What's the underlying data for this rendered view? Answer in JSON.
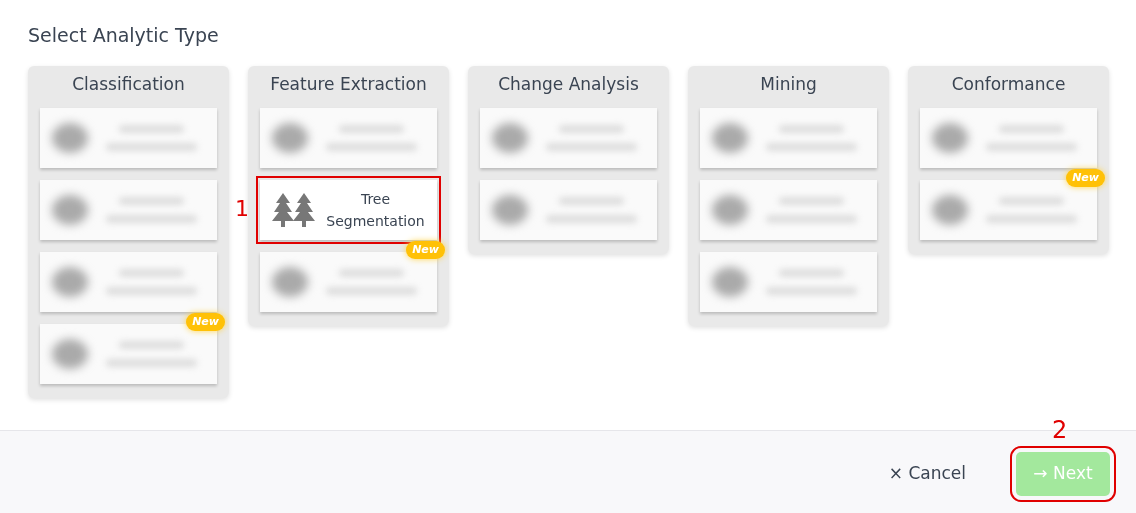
{
  "title": "Select Analytic Type",
  "categories": [
    {
      "name": "Classification",
      "tiles": [
        {
          "kind": "blurred"
        },
        {
          "kind": "blurred"
        },
        {
          "kind": "blurred"
        },
        {
          "kind": "blurred",
          "badge": "New"
        }
      ]
    },
    {
      "name": "Feature Extraction",
      "tiles": [
        {
          "kind": "blurred"
        },
        {
          "kind": "clear",
          "label": "Tree Segmentation",
          "callout": "1"
        },
        {
          "kind": "blurred",
          "badge": "New"
        }
      ]
    },
    {
      "name": "Change Analysis",
      "tiles": [
        {
          "kind": "blurred"
        },
        {
          "kind": "blurred"
        }
      ]
    },
    {
      "name": "Mining",
      "tiles": [
        {
          "kind": "blurred"
        },
        {
          "kind": "blurred"
        },
        {
          "kind": "blurred"
        }
      ]
    },
    {
      "name": "Conformance",
      "tiles": [
        {
          "kind": "blurred"
        },
        {
          "kind": "blurred",
          "badge": "New"
        }
      ]
    }
  ],
  "footer": {
    "cancel": {
      "icon": "×",
      "label": "Cancel"
    },
    "next": {
      "icon": "→",
      "label": "Next",
      "disabled": true,
      "callout": "2"
    }
  }
}
